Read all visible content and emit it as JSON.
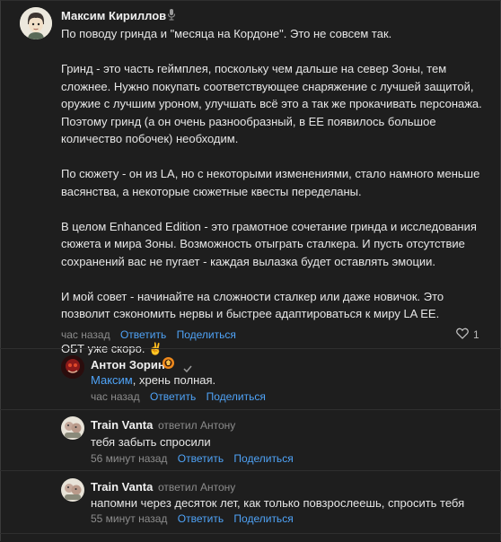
{
  "main_comment": {
    "author": "Максим Кириллов",
    "paragraphs": [
      "По поводу гринда и \"месяца на Кордоне\". Это не совсем так.",
      "Гринд - это часть геймплея, поскольку чем дальше на север Зоны, тем сложнее. Нужно покупать соответствующее снаряжение с лучшей защитой, оружие с лучшим уроном, улучшать всё это а так же прокачивать персонажа. Поэтому гринд (а он очень разнообразный, в ЕЕ появилось большое количество побочек) необходим.",
      "По сюжету - он из LA, но с некоторыми изменениями, стало намного меньше васянства, а некоторые сюжетные квесты переделаны.",
      "В целом Enhanced Edition - это грамотное сочетание гринда и исследования сюжета и мира Зоны. Возможность отыграть сталкера. И пусть отсутствие сохранений вас не пугает - каждая вылазка будет оставлять эмоции.",
      "И мой совет - начинайте на сложности сталкер или даже новичок. Это позволит сэкономить нервы и быстрее адаптироваться к миру LA EE.",
      "ОБТ уже скоро. ✌️"
    ],
    "time": "час назад",
    "reply_label": "Ответить",
    "share_label": "Поделиться",
    "like_count": "1"
  },
  "replies": [
    {
      "author": "Антон Зорин",
      "mention": "Максим",
      "text": ", хрень полная.",
      "time": "час назад",
      "reply_label": "Ответить",
      "share_label": "Поделиться"
    },
    {
      "author": "Train Vanta",
      "replied_to": "ответил Антону",
      "text": "тебя забыть спросили",
      "time": "56 минут назад",
      "reply_label": "Ответить",
      "share_label": "Поделиться"
    },
    {
      "author": "Train Vanta",
      "replied_to": "ответил Антону",
      "text": "напомни через десяток лет, как только повзрослеешь, спросить тебя",
      "time": "55 минут назад",
      "reply_label": "Ответить",
      "share_label": "Поделиться"
    }
  ],
  "colors": {
    "background": "#1e1e1e",
    "link": "#4fa3f7",
    "muted": "#8c8c8c",
    "text": "#e6e6e6"
  }
}
